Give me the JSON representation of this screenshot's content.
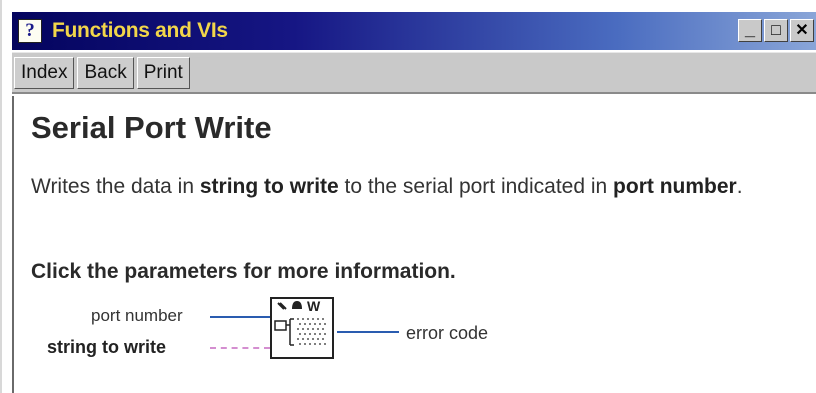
{
  "window": {
    "help_glyph": "?",
    "title": "Functions and VIs",
    "controls": {
      "minimize": "_",
      "maximize": "□",
      "close": "✕"
    }
  },
  "toolbar": {
    "index_label": "Index",
    "back_label": "Back",
    "print_label": "Print"
  },
  "content": {
    "heading": "Serial Port Write",
    "description": {
      "part1": "Writes the data in ",
      "bold1": "string to write",
      "part2": " to the serial port indicated in ",
      "bold2": "port number",
      "part3": "."
    },
    "click_info": "Click the parameters for more information.",
    "diagram": {
      "input_port": "port number",
      "input_string": "string to write",
      "output_error": "error code"
    }
  },
  "colors": {
    "title_gradient_start": "#04045e",
    "title_text": "#f2d64a",
    "wire_numeric": "#2a5cb0",
    "wire_string": "#d48ed0"
  }
}
